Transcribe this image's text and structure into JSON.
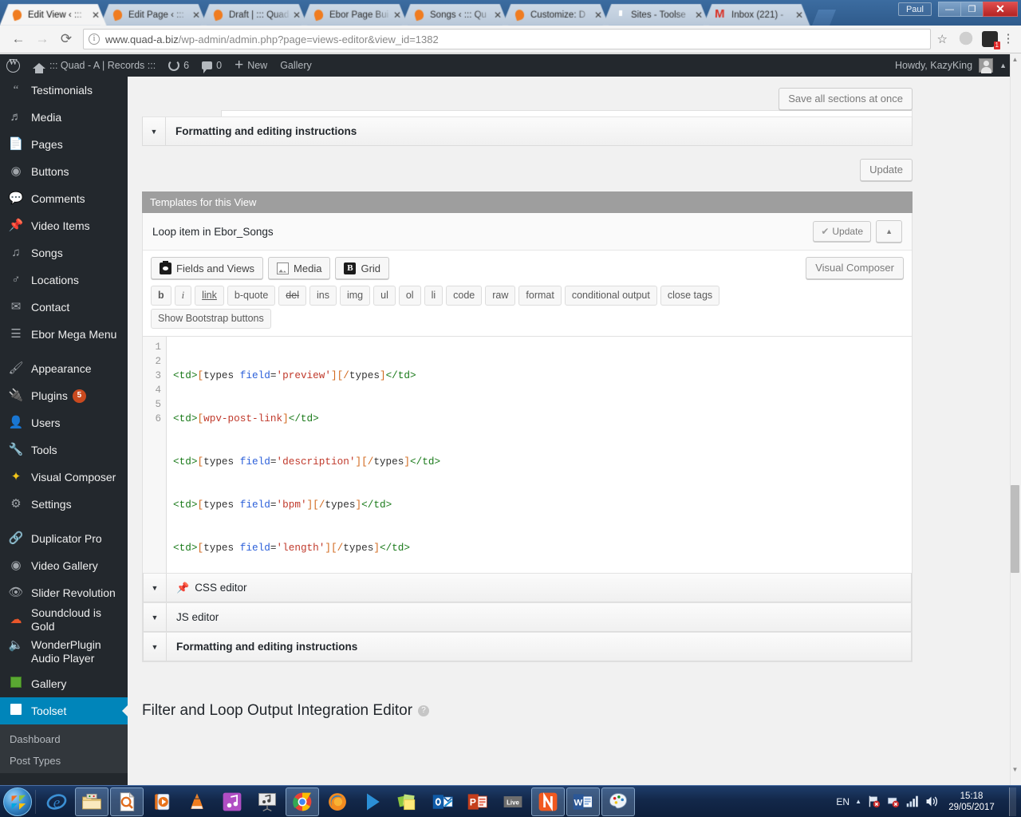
{
  "browser": {
    "tabs": [
      {
        "title": "Edit View ‹ ::: ",
        "icon": "wordpress-icon",
        "active": true
      },
      {
        "title": "Edit Page ‹ ::: ",
        "icon": "wordpress-icon",
        "active": false
      },
      {
        "title": "Draft | ::: Quad",
        "icon": "wordpress-icon",
        "active": false
      },
      {
        "title": "Ebor Page Bui",
        "icon": "wordpress-icon",
        "active": false
      },
      {
        "title": "Songs ‹ ::: Qu",
        "icon": "wordpress-icon",
        "active": false
      },
      {
        "title": "Customize: D",
        "icon": "wordpress-icon",
        "active": false
      },
      {
        "title": "Sites - Toolse",
        "icon": "toolset-icon",
        "active": false
      },
      {
        "title": "Inbox (221) -",
        "icon": "gmail-icon",
        "active": false
      }
    ],
    "close_label": "✕",
    "window": {
      "user": "Paul",
      "minimize": "—",
      "maximize": "❐",
      "close": "✕"
    },
    "address": {
      "url_domain": "www.quad-a.biz",
      "url_path": "/wp-admin/admin.php?page=views-editor&view_id=1382",
      "back": "←",
      "forward": "→",
      "reload": "⟳",
      "star": "☆",
      "ext_badge": "1",
      "menu": "⋮"
    }
  },
  "adminbar": {
    "site_name": "::: Quad - A | Records :::",
    "updates_count": "6",
    "comments_count": "0",
    "new_label": "New",
    "gallery_label": "Gallery",
    "howdy": "Howdy, KazyKing"
  },
  "sidebar": {
    "items": [
      {
        "label": "Testimonials",
        "icon": "quote-icon"
      },
      {
        "label": "Media",
        "icon": "media-icon"
      },
      {
        "label": "Pages",
        "icon": "pages-icon"
      },
      {
        "label": "Buttons",
        "icon": "button-icon"
      },
      {
        "label": "Comments",
        "icon": "comments-icon"
      },
      {
        "label": "Video Items",
        "icon": "pin-icon"
      },
      {
        "label": "Songs",
        "icon": "music-note-icon"
      },
      {
        "label": "Locations",
        "icon": "location-pin-icon"
      },
      {
        "label": "Contact",
        "icon": "envelope-icon"
      },
      {
        "label": "Ebor Mega Menu",
        "icon": "menu-lines-icon"
      },
      {
        "label": "Appearance",
        "icon": "paintbrush-icon",
        "separator_before": true
      },
      {
        "label": "Plugins",
        "icon": "plug-icon",
        "badge": "5"
      },
      {
        "label": "Users",
        "icon": "user-icon"
      },
      {
        "label": "Tools",
        "icon": "wrench-icon"
      },
      {
        "label": "Visual Composer",
        "icon": "vc-icon"
      },
      {
        "label": "Settings",
        "icon": "sliders-icon"
      },
      {
        "label": "Duplicator Pro",
        "icon": "share-icon",
        "separator_before": true
      },
      {
        "label": "Video Gallery",
        "icon": "video-gallery-icon"
      },
      {
        "label": "Slider Revolution",
        "icon": "eye-icon"
      },
      {
        "label": "Soundcloud is Gold",
        "icon": "cloud-icon"
      },
      {
        "label": "WonderPlugin Audio Player",
        "icon": "speaker-icon"
      },
      {
        "label": "Gallery",
        "icon": "green-square-icon"
      },
      {
        "label": "Toolset",
        "icon": "toolset-icon",
        "current": true
      }
    ],
    "submenu": [
      {
        "label": "Dashboard"
      },
      {
        "label": "Post Types"
      }
    ]
  },
  "main": {
    "save_all_label": "Save all sections at once",
    "top_accordion": {
      "label": "Formatting and editing instructions",
      "arrow": "▼"
    },
    "update_label": "Update",
    "templates_header": "Templates for this View",
    "panel": {
      "title": "Loop item in Ebor_Songs",
      "update_label": "Update",
      "check_glyph": "✔",
      "collapse_arrow": "▲",
      "visual_composer_label": "Visual Composer",
      "tool_buttons": [
        {
          "label": "Fields and Views",
          "icon": "fields-and-views-icon"
        },
        {
          "label": "Media",
          "icon": "media-image-icon"
        },
        {
          "label": "Grid",
          "icon": "grid-icon"
        }
      ],
      "quicktags": [
        "b",
        "i",
        "link",
        "b-quote",
        "del",
        "ins",
        "img",
        "ul",
        "ol",
        "li",
        "code",
        "raw",
        "format",
        "conditional output",
        "close tags"
      ],
      "bootstrap_label": "Show Bootstrap buttons",
      "code": {
        "line_numbers": [
          "1",
          "2",
          "3",
          "4",
          "5",
          "6"
        ],
        "lines": [
          "<td>[types field='preview'][/types]</td>",
          "<td>[wpv-post-link]</td>",
          "<td>[types field='description'][/types]</td>",
          "<td>[types field='bpm'][/types]</td>",
          "<td>[types field='length'][/types]</td>",
          ""
        ]
      }
    },
    "sections": [
      {
        "label": "CSS editor",
        "arrow": "▼",
        "pin": "📌",
        "bold": false,
        "has_pin": true
      },
      {
        "label": "JS editor",
        "arrow": "▼",
        "bold": false,
        "has_pin": false
      },
      {
        "label": "Formatting and editing instructions",
        "arrow": "▼",
        "bold": true,
        "has_pin": false
      }
    ],
    "footer_title": "Filter and Loop Output Integration Editor",
    "footer_help": "?"
  },
  "taskbar": {
    "items": [
      {
        "name": "internet-explorer-icon",
        "open": false
      },
      {
        "name": "file-explorer-icon",
        "open": true
      },
      {
        "name": "search-document-icon",
        "open": true
      },
      {
        "name": "media-player-icon",
        "open": false
      },
      {
        "name": "vlc-icon",
        "open": false
      },
      {
        "name": "itunes-icon",
        "open": false
      },
      {
        "name": "media-library-icon",
        "open": false
      },
      {
        "name": "google-chrome-icon",
        "open": true
      },
      {
        "name": "firefox-icon",
        "open": false
      },
      {
        "name": "play-icon",
        "open": false
      },
      {
        "name": "sticky-notes-icon",
        "open": false
      },
      {
        "name": "outlook-icon",
        "open": false
      },
      {
        "name": "powerpoint-icon",
        "open": false
      },
      {
        "name": "live-writer-icon",
        "open": false
      },
      {
        "name": "nitro-pdf-icon",
        "open": true
      },
      {
        "name": "word-icon",
        "open": true
      },
      {
        "name": "paint-icon",
        "open": true
      }
    ],
    "tray": {
      "language": "EN",
      "arrow": "▲",
      "time": "15:18",
      "date": "29/05/2017"
    }
  },
  "colors": {
    "wp_blue": "#0085ba",
    "wp_dark": "#23282d",
    "badge_orange": "#ca4a1f",
    "tag_green": "#1a7a1a",
    "bracket_orange": "#d2691e",
    "attr_blue": "#2b5fd9",
    "string_red": "#c0392b"
  }
}
